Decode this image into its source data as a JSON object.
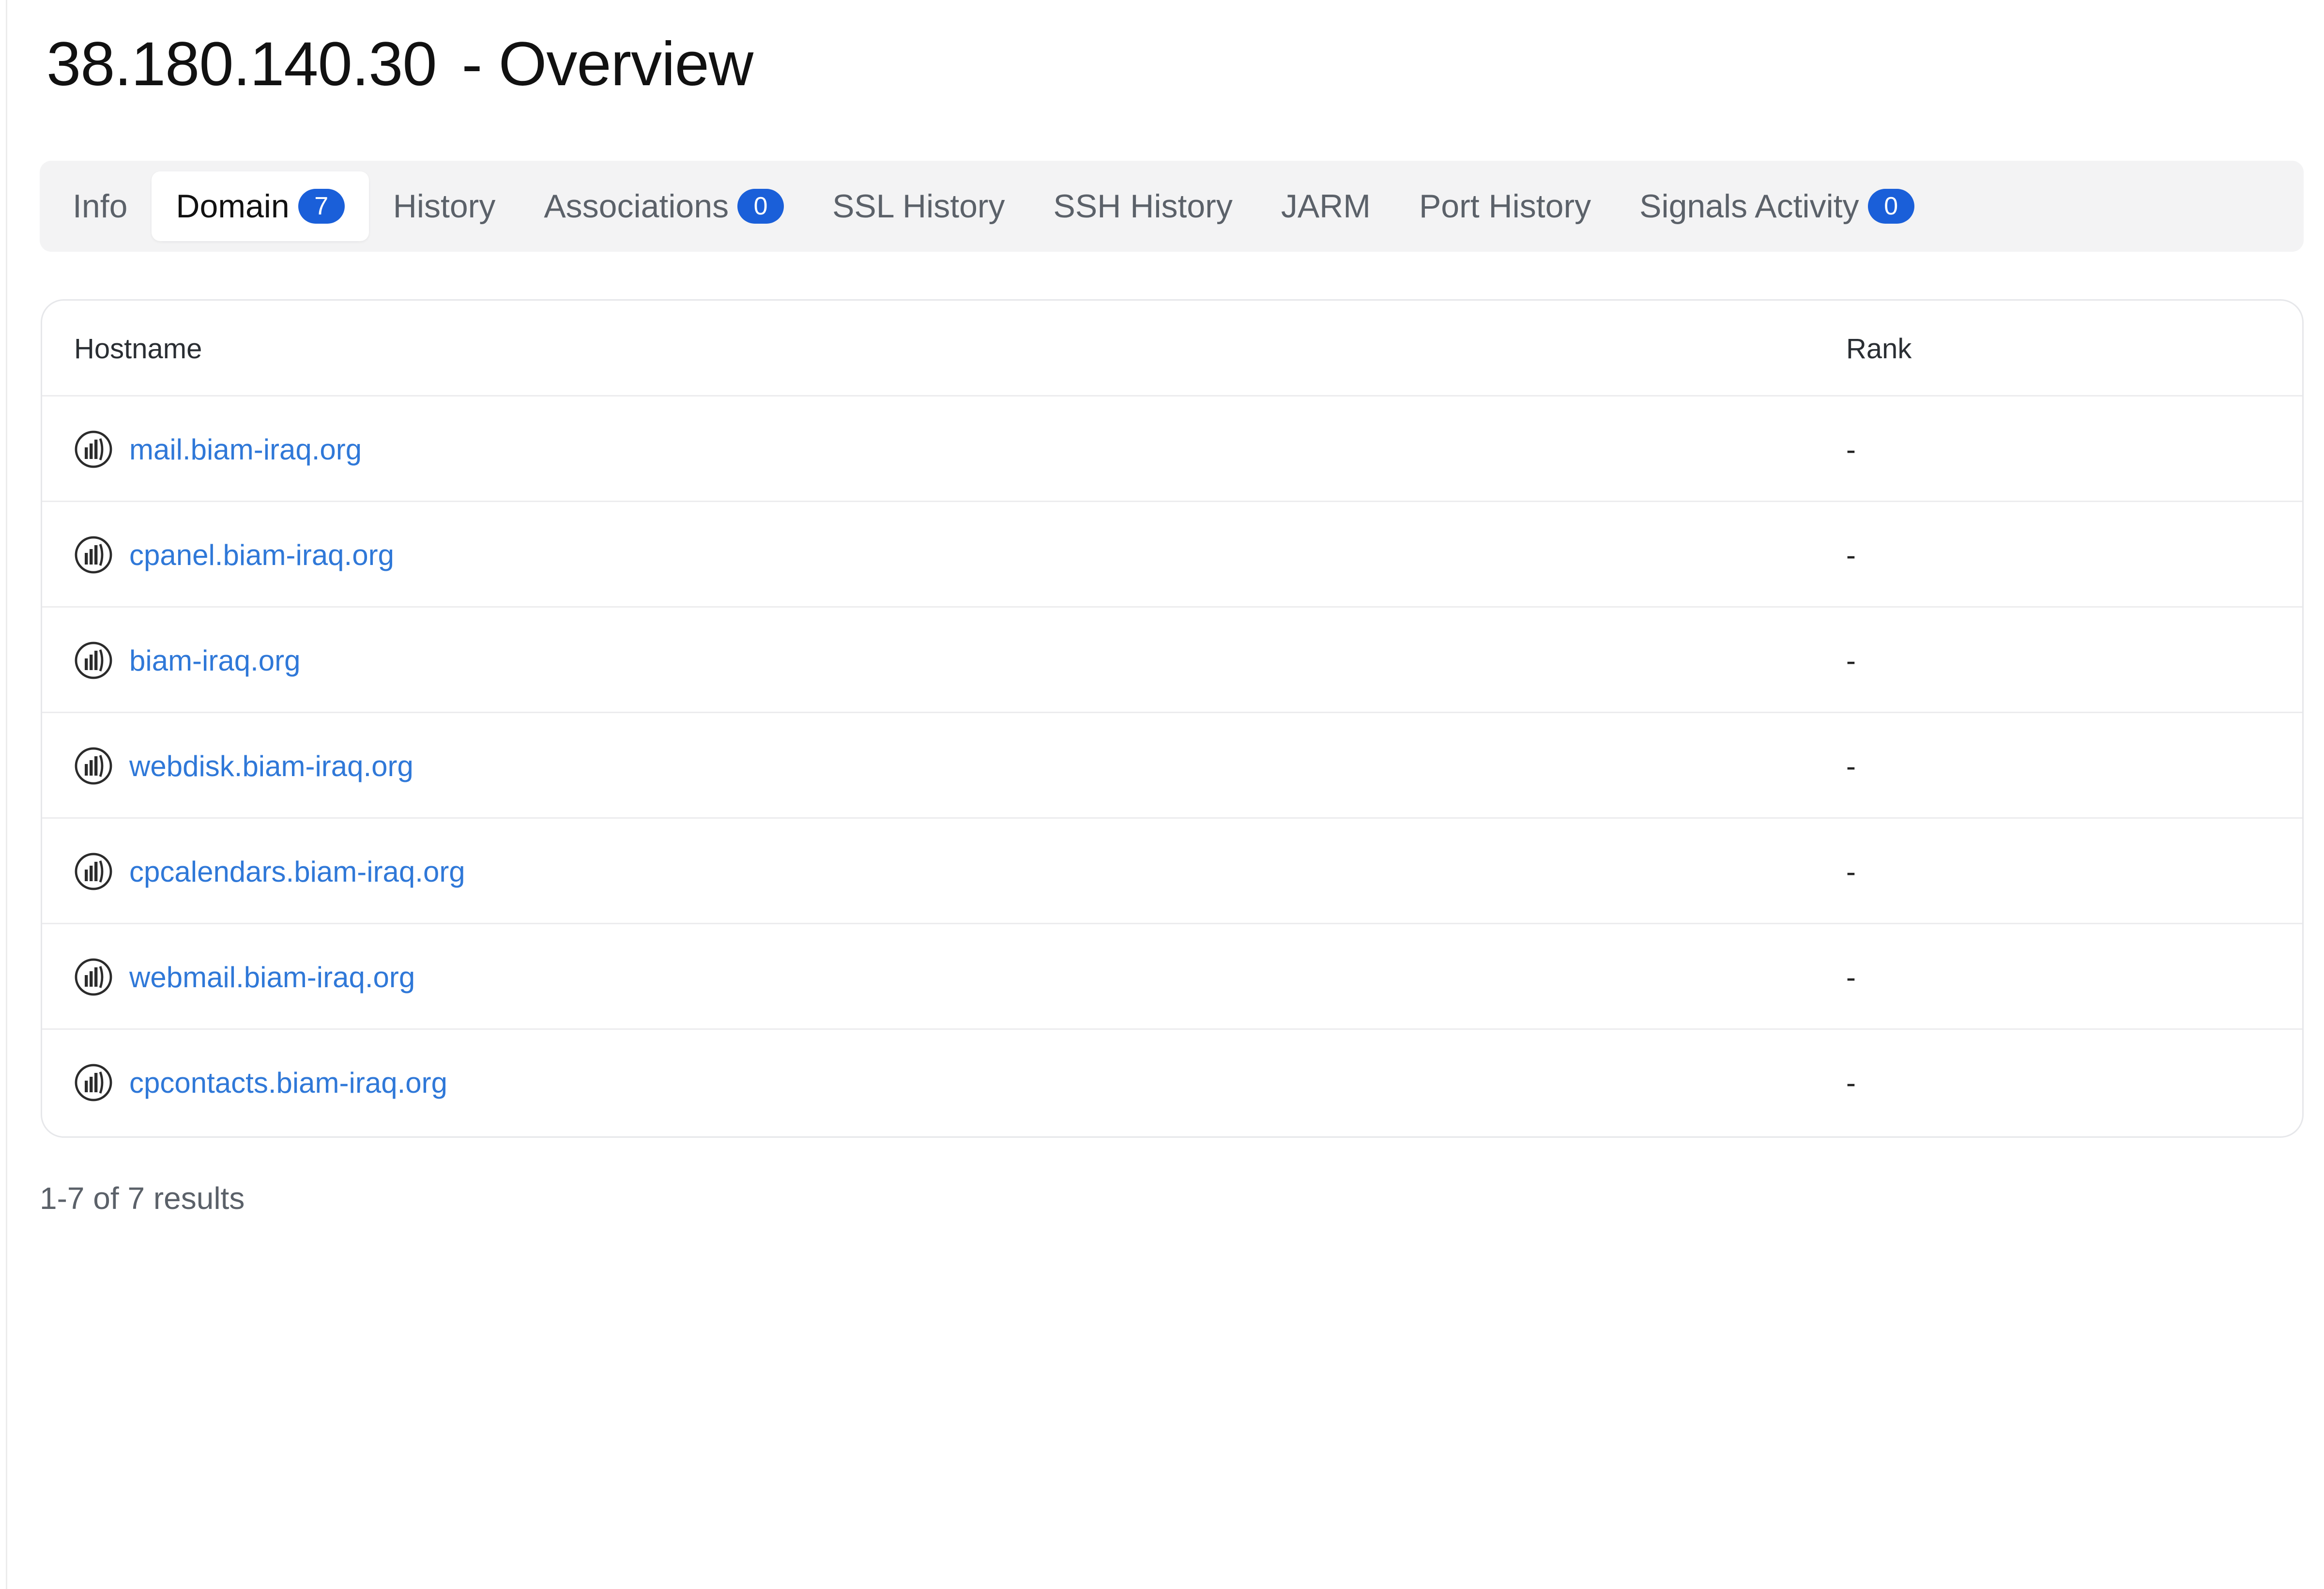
{
  "header": {
    "ip": "38.180.140.30",
    "suffix": "- Overview"
  },
  "tabs": [
    {
      "label": "Info",
      "badge": null,
      "active": false
    },
    {
      "label": "Domain",
      "badge": "7",
      "active": true
    },
    {
      "label": "History",
      "badge": null,
      "active": false
    },
    {
      "label": "Associations",
      "badge": "0",
      "active": false
    },
    {
      "label": "SSL History",
      "badge": null,
      "active": false
    },
    {
      "label": "SSH History",
      "badge": null,
      "active": false
    },
    {
      "label": "JARM",
      "badge": null,
      "active": false
    },
    {
      "label": "Port History",
      "badge": null,
      "active": false
    },
    {
      "label": "Signals Activity",
      "badge": "0",
      "active": false
    }
  ],
  "table": {
    "columns": {
      "hostname": "Hostname",
      "rank": "Rank"
    },
    "rows": [
      {
        "hostname": "mail.biam-iraq.org",
        "rank": "-"
      },
      {
        "hostname": "cpanel.biam-iraq.org",
        "rank": "-"
      },
      {
        "hostname": "biam-iraq.org",
        "rank": "-"
      },
      {
        "hostname": "webdisk.biam-iraq.org",
        "rank": "-"
      },
      {
        "hostname": "cpcalendars.biam-iraq.org",
        "rank": "-"
      },
      {
        "hostname": "webmail.biam-iraq.org",
        "rank": "-"
      },
      {
        "hostname": "cpcontacts.biam-iraq.org",
        "rank": "-"
      }
    ],
    "row_icon": "domain-icon"
  },
  "pagination": {
    "summary": "1-7 of 7 results"
  },
  "colors": {
    "link": "#2f78d8",
    "badge": "#1a5fd9",
    "tabbar_bg": "#f3f3f4"
  }
}
